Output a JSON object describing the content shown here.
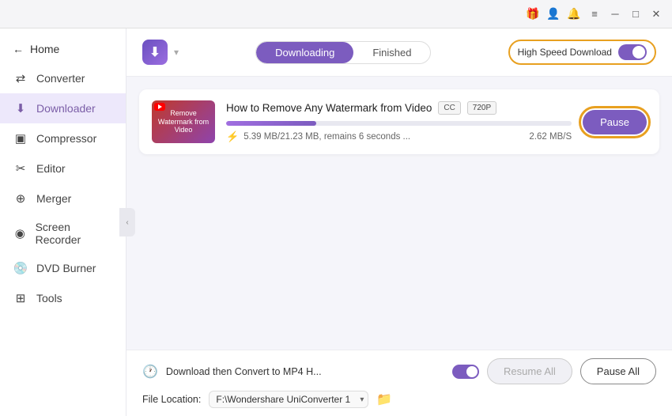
{
  "titleBar": {
    "icons": [
      "gift-icon",
      "user-icon",
      "bell-icon",
      "menu-icon",
      "minimize-icon",
      "maximize-icon",
      "close-icon"
    ]
  },
  "sidebar": {
    "home": "Home",
    "items": [
      {
        "id": "converter",
        "label": "Converter",
        "icon": "⇄"
      },
      {
        "id": "downloader",
        "label": "Downloader",
        "icon": "⬇"
      },
      {
        "id": "compressor",
        "label": "Compressor",
        "icon": "⊞"
      },
      {
        "id": "editor",
        "label": "Editor",
        "icon": "✂"
      },
      {
        "id": "merger",
        "label": "Merger",
        "icon": "⊕"
      },
      {
        "id": "screen-recorder",
        "label": "Screen Recorder",
        "icon": "◉"
      },
      {
        "id": "dvd-burner",
        "label": "DVD Burner",
        "icon": "💿"
      },
      {
        "id": "tools",
        "label": "Tools",
        "icon": "⊞"
      }
    ]
  },
  "header": {
    "tabs": {
      "downloading": "Downloading",
      "finished": "Finished"
    },
    "activeTab": "downloading",
    "highSpeedLabel": "High Speed Download"
  },
  "downloadCard": {
    "title": "How to Remove Any Watermark from Video",
    "badges": [
      "CC",
      "720P"
    ],
    "progress": 26,
    "stats": "5.39 MB/21.23 MB, remains 6 seconds ...",
    "speed": "2.62 MB/S",
    "pauseLabel": "Pause",
    "thumbnailText": "Remove\nWatermark\nfrom Video"
  },
  "footer": {
    "convertLabel": "Download then Convert to MP4 H...",
    "fileLocationLabel": "File Location:",
    "fileLocationValue": "F:\\Wondershare UniConverter 1",
    "resumeAllLabel": "Resume All",
    "pauseAllLabel": "Pause All"
  }
}
